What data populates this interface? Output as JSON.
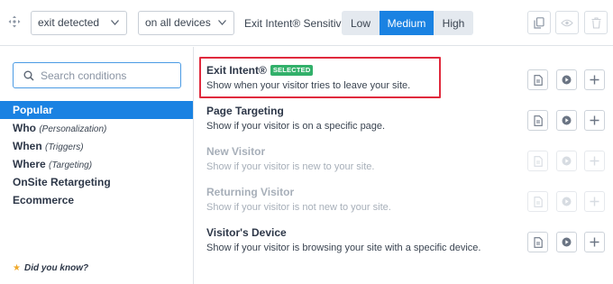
{
  "toolbar": {
    "trigger_select": "exit detected",
    "device_select": "on all devices",
    "sensitivity_label": "Exit Intent® Sensitivity:",
    "sensitivity_options": [
      "Low",
      "Medium",
      "High"
    ],
    "sensitivity_selected": "Medium",
    "icons": [
      "move-icon",
      "duplicate-icon",
      "preview-icon",
      "delete-icon"
    ]
  },
  "sidebar": {
    "search_placeholder": "Search conditions",
    "categories": [
      {
        "label": "Popular",
        "sub": "",
        "active": true
      },
      {
        "label": "Who",
        "sub": "(Personalization)",
        "active": false
      },
      {
        "label": "When",
        "sub": "(Triggers)",
        "active": false
      },
      {
        "label": "Where",
        "sub": "(Targeting)",
        "active": false
      },
      {
        "label": "OnSite Retargeting",
        "sub": "",
        "active": false
      },
      {
        "label": "Ecommerce",
        "sub": "",
        "active": false
      }
    ],
    "did_you_know": "Did you know?"
  },
  "conditions": [
    {
      "title": "Exit Intent®",
      "badge": "SELECTED",
      "description": "Show when your visitor tries to leave your site.",
      "enabled": true
    },
    {
      "title": "Page Targeting",
      "badge": "",
      "description": "Show if your visitor is on a specific page.",
      "enabled": true
    },
    {
      "title": "New Visitor",
      "badge": "",
      "description": "Show if your visitor is new to your site.",
      "enabled": false
    },
    {
      "title": "Returning Visitor",
      "badge": "",
      "description": "Show if your visitor is not new to your site.",
      "enabled": false
    },
    {
      "title": "Visitor's Device",
      "badge": "",
      "description": "Show if your visitor is browsing your site with a specific device.",
      "enabled": true
    }
  ],
  "colors": {
    "accent": "#1a82e2",
    "selected_badge": "#32b06a",
    "highlight_border": "#e02a3d",
    "disabled_text": "#a7afb9"
  }
}
